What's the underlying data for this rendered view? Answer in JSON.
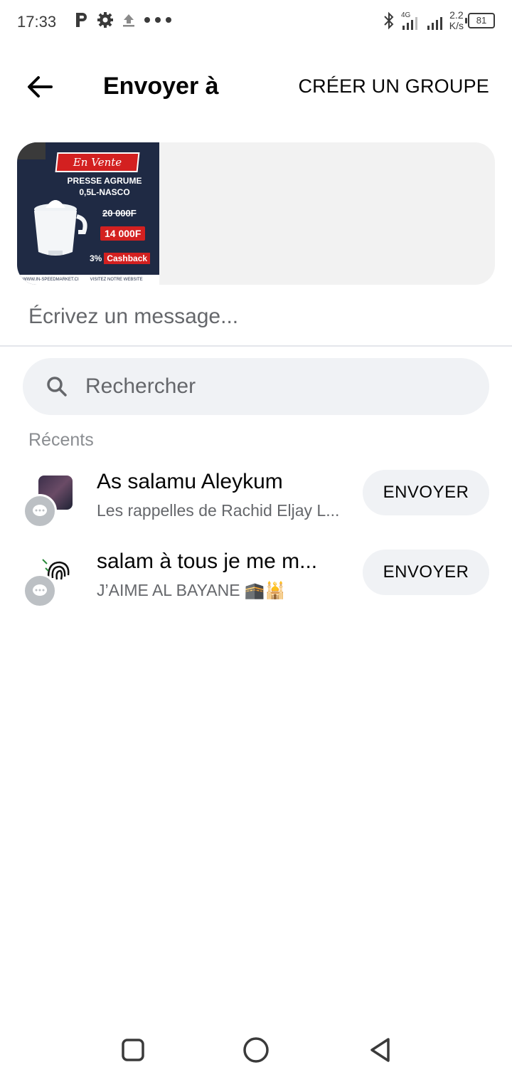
{
  "status_bar": {
    "time": "17:33",
    "network": "4G",
    "speed_value": "2.2",
    "speed_unit": "K/s",
    "battery": "81"
  },
  "header": {
    "title": "Envoyer à",
    "create_group_label": "CRÉER UN GROUPE",
    "back_icon": "arrow-left-icon"
  },
  "preview": {
    "banner_text": "En Vente",
    "product_name": "PRESSE AGRUME 0,5L-NASCO",
    "old_price": "20 000F",
    "new_price": "14 000F",
    "cashback_percent": "3%",
    "cashback_label": "Cashback",
    "footer_left": "WWW.IN-SPEEDMARKET.CI",
    "footer_right": "VISITEZ NOTRE WEBSITE"
  },
  "message": {
    "placeholder": "Écrivez un message..."
  },
  "search": {
    "placeholder": "Rechercher"
  },
  "recents": {
    "label": "Récents",
    "items": [
      {
        "title": "As salamu Aleykum",
        "subtitle": "Les rappelles de Rachid Eljay L...",
        "button": "ENVOYER"
      },
      {
        "title": "salam à tous je me m...",
        "subtitle": "J’AIME AL BAYANE 🕋🕌",
        "button": "ENVOYER"
      }
    ]
  },
  "colors": {
    "accent_red": "#d32020",
    "secondary_text": "#65676b",
    "button_bg": "#f0f2f5"
  }
}
